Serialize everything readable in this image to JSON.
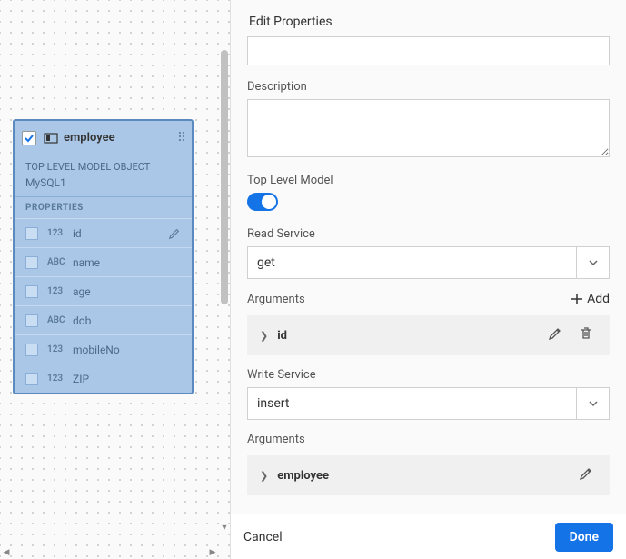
{
  "canvas": {
    "model": {
      "title": "employee",
      "subtitle": "TOP LEVEL MODEL OBJECT",
      "datasource": "MySQL1",
      "section_label": "PROPERTIES",
      "properties": [
        {
          "type": "123",
          "name": "id",
          "key": true
        },
        {
          "type": "ABC",
          "name": "name",
          "key": false
        },
        {
          "type": "123",
          "name": "age",
          "key": false
        },
        {
          "type": "ABC",
          "name": "dob",
          "key": false
        },
        {
          "type": "123",
          "name": "mobileNo",
          "key": false
        },
        {
          "type": "123",
          "name": "ZIP",
          "key": false
        }
      ]
    }
  },
  "panel": {
    "title": "Edit Properties",
    "description_label": "Description",
    "description_value": "",
    "toplevel_label": "Top Level Model",
    "toplevel_on": true,
    "read_service_label": "Read Service",
    "read_service_value": "get",
    "read_args_label": "Arguments",
    "add_label": "Add",
    "read_args": [
      {
        "name": "id"
      }
    ],
    "write_service_label": "Write Service",
    "write_service_value": "insert",
    "write_args_label": "Arguments",
    "write_args": [
      {
        "name": "employee"
      }
    ],
    "cancel_label": "Cancel",
    "done_label": "Done"
  }
}
